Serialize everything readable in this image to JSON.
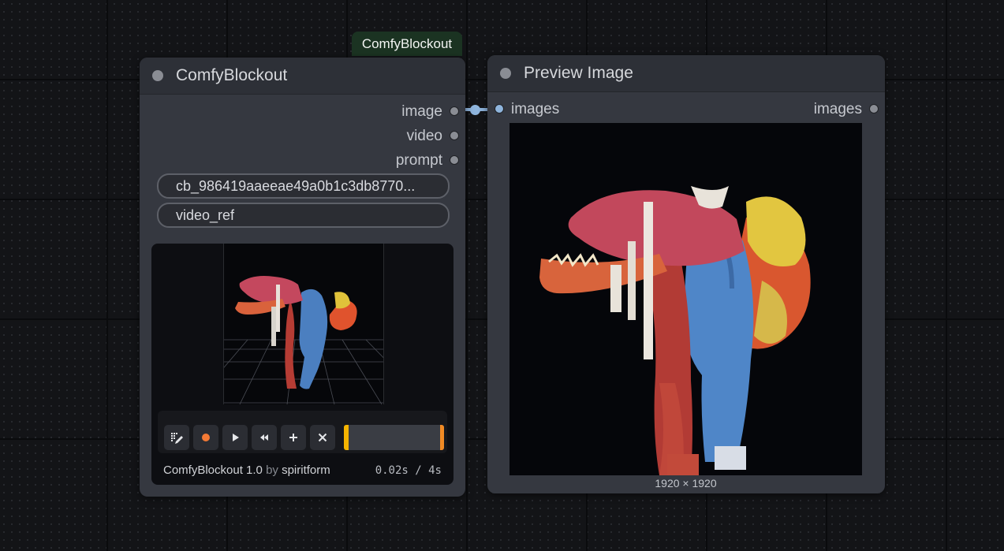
{
  "group_badge": "ComfyBlockout",
  "blockout_node": {
    "title": "ComfyBlockout",
    "outputs": [
      {
        "label": "image",
        "connected": true
      },
      {
        "label": "video",
        "connected": false
      },
      {
        "label": "prompt",
        "connected": false
      }
    ],
    "widgets": [
      {
        "value": "cb_986419aaeeae49a0b1c3db8770..."
      },
      {
        "value": "video_ref"
      }
    ],
    "controls": [
      {
        "icon": "grid-pencil-icon"
      },
      {
        "icon": "record-icon"
      },
      {
        "icon": "play-icon"
      },
      {
        "icon": "rewind-icon"
      },
      {
        "icon": "plus-icon"
      },
      {
        "icon": "close-icon"
      }
    ],
    "timeline_progress": 0.005,
    "footer": {
      "product": "ComfyBlockout 1.0",
      "by": "by",
      "author": "spiritform",
      "time": "0.02s / 4s"
    }
  },
  "preview_node": {
    "title": "Preview Image",
    "input_label": "images",
    "output_label": "images",
    "image_size": "1920 × 1920"
  },
  "colors": {
    "link": "#8fb5dd",
    "record": "#f47a35",
    "timeline_marker": "#f5b400",
    "badge_bg": "#1b3322"
  }
}
